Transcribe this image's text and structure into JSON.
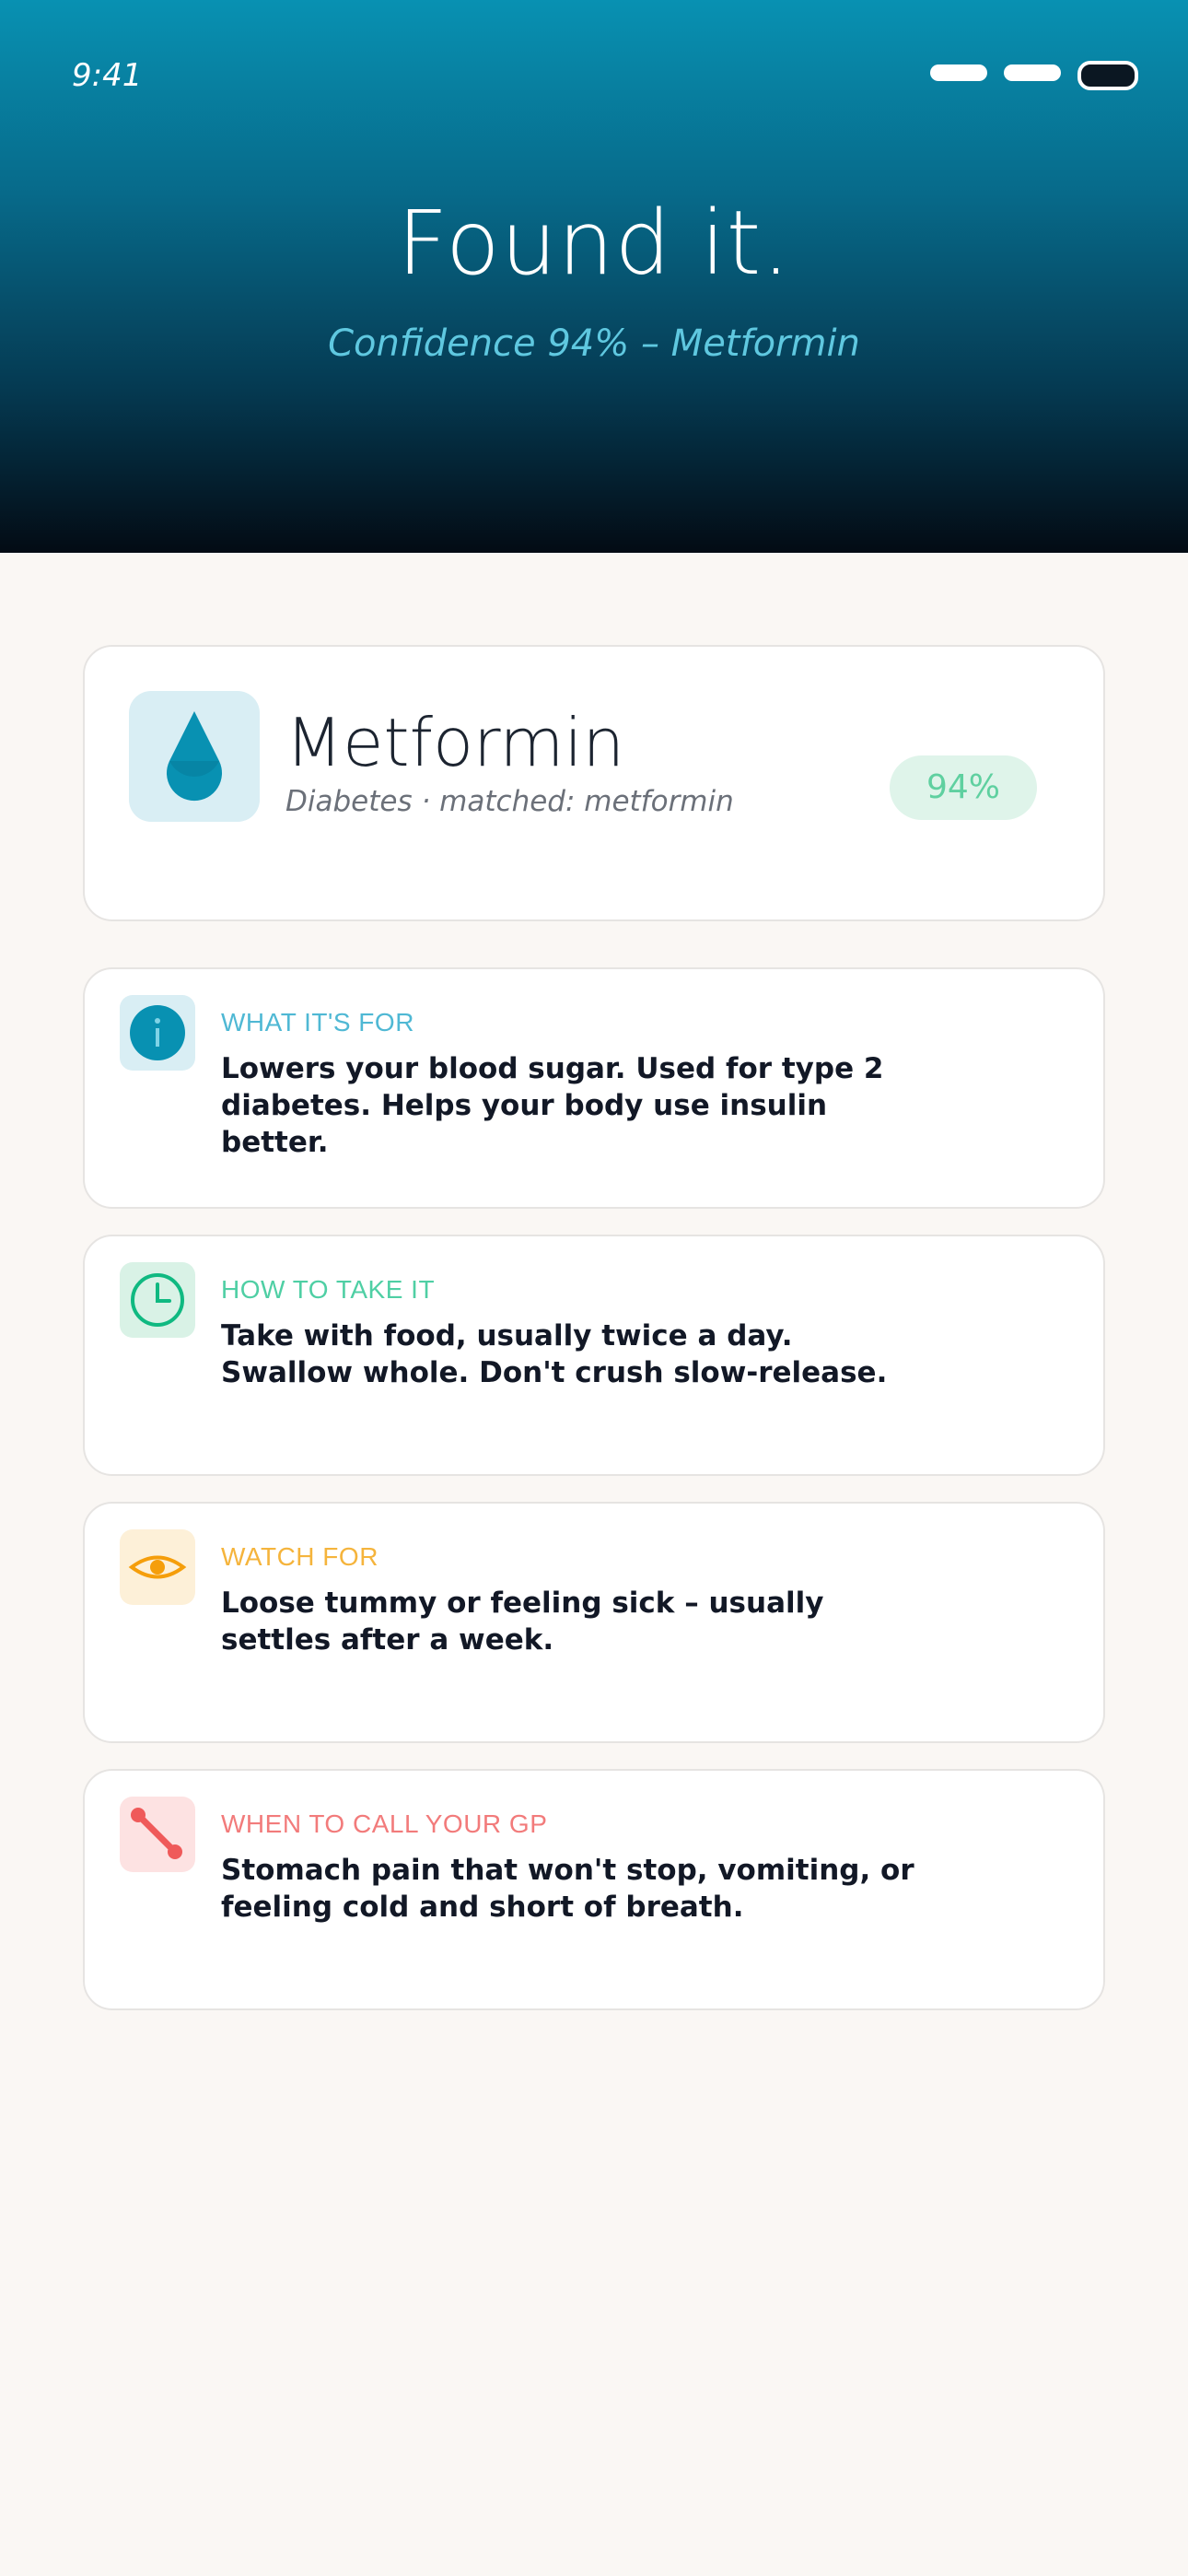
{
  "status_bar": {
    "time": "9:41"
  },
  "hero": {
    "title": "Found it.",
    "subtitle": "Confidence 94% – Metformin"
  },
  "medication": {
    "icon": "water-drop-icon",
    "name": "Metformin",
    "subtitle": "Diabetes · matched: metformin",
    "confidence_badge": "94%"
  },
  "info_cards": [
    {
      "icon": "info-icon",
      "label": "WHAT IT'S FOR",
      "body": "Lowers your blood sugar. Used for type 2 diabetes. Helps your body use insulin better.",
      "accent": "#0891b2",
      "icon_bg": "#d9eef4"
    },
    {
      "icon": "clock-icon",
      "label": "HOW TO TAKE IT",
      "body": "Take with food, usually twice a day. Swallow whole. Don't crush slow-release.",
      "accent": "#10b981",
      "icon_bg": "#d9f2e6"
    },
    {
      "icon": "eye-icon",
      "label": "WATCH FOR",
      "body": "Loose tummy or feeling sick – usually settles after a week.",
      "accent": "#f59e0b",
      "icon_bg": "#fdf0d8"
    },
    {
      "icon": "phone-icon",
      "label": "WHEN TO CALL YOUR GP",
      "body": "Stomach pain that won't stop, vomiting, or feeling cold and short of breath.",
      "accent": "#ef5a5a",
      "icon_bg": "#fde2e2"
    }
  ],
  "colors": {
    "hero_top": "#0891b2",
    "hero_bottom": "#030b14",
    "page_bg": "#faf7f4",
    "badge_bg": "#dff4ea",
    "badge_text": "#5fd0a0"
  }
}
